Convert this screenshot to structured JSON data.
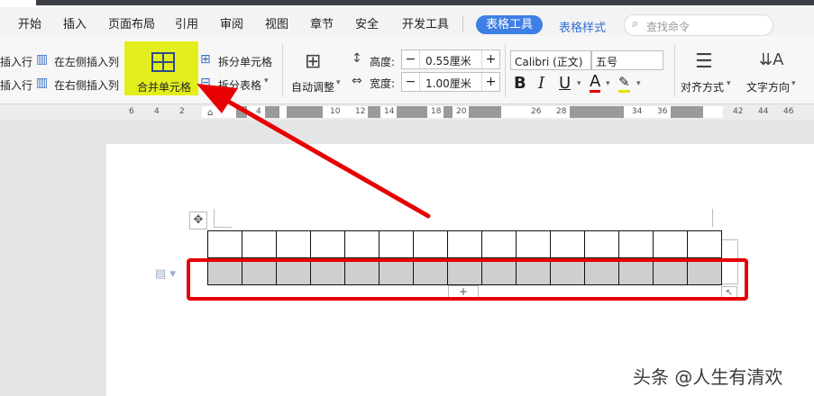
{
  "menu": {
    "items": [
      "开始",
      "插入",
      "页面布局",
      "引用",
      "审阅",
      "视图",
      "章节",
      "安全",
      "开发工具"
    ],
    "active_tab": "表格工具",
    "style_tab": "表格样式",
    "search_placeholder": "查找命令"
  },
  "ribbon": {
    "insert_row_above": "插入行",
    "insert_row_below": "插入行",
    "insert_col_left": "在左侧插入列",
    "insert_col_right": "在右侧插入列",
    "merge_cells": "合并单元格",
    "split_cells": "拆分单元格",
    "split_table": "拆分表格",
    "auto_adjust": "自动调整",
    "height_label": "高度:",
    "height_value": "0.55厘米",
    "width_label": "宽度:",
    "width_value": "1.00厘米",
    "font_name": "Calibri (正文)",
    "font_size": "五号",
    "align": "对齐方式",
    "text_direction": "文字方向",
    "bold": "B",
    "italic": "I",
    "underline": "U",
    "font_color": "A"
  },
  "ruler": {
    "ticks": [
      "6",
      "4",
      "2",
      "4",
      "10",
      "12",
      "14",
      "18",
      "20",
      "26",
      "28",
      "34",
      "36",
      "42",
      "44",
      "46"
    ]
  },
  "table": {
    "columns": 15,
    "rows": 2,
    "selected_row": 2
  },
  "colors": {
    "highlight": "#e3ef1c",
    "annotation": "#e60000",
    "active_tab": "#3e7fe6"
  },
  "watermark": "头条 @人生有清欢"
}
